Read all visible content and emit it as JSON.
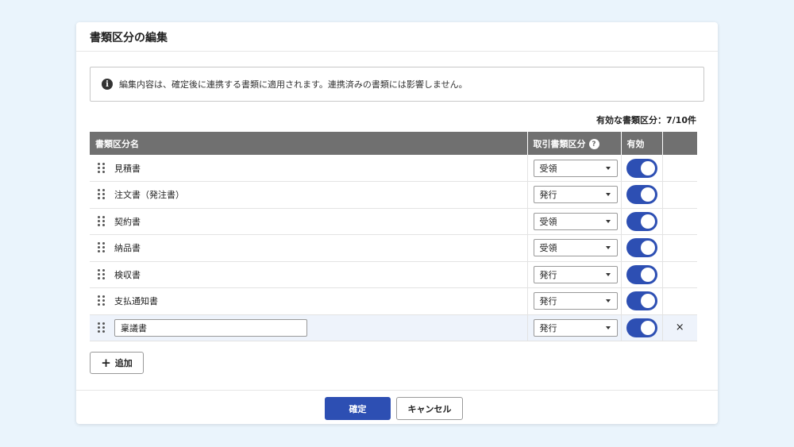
{
  "dialog": {
    "title": "書類区分の編集",
    "notice": "編集内容は、確定後に連携する書類に適用されます。連携済みの書類には影響しません。",
    "info_icon": "info-icon",
    "count_text": "有効な書類区分：7/10件"
  },
  "table": {
    "headers": {
      "name": "書類区分名",
      "type": "取引書類区分",
      "enabled": "有効"
    },
    "rows": [
      {
        "name": "見積書",
        "type": "受領",
        "enabled": true
      },
      {
        "name": "注文書（発注書）",
        "type": "発行",
        "enabled": true
      },
      {
        "name": "契約書",
        "type": "受領",
        "enabled": true
      },
      {
        "name": "納品書",
        "type": "受領",
        "enabled": true
      },
      {
        "name": "検収書",
        "type": "発行",
        "enabled": true
      },
      {
        "name": "支払通知書",
        "type": "発行",
        "enabled": true
      },
      {
        "name": "稟議書",
        "type": "発行",
        "enabled": true,
        "editing": true,
        "remove": "×"
      }
    ]
  },
  "actions": {
    "add_label": "追加",
    "confirm_label": "確定",
    "cancel_label": "キャンセル"
  },
  "colors": {
    "primary": "#2d4fb3",
    "header_bg": "#707070",
    "page_bg": "#eaf4fc"
  }
}
